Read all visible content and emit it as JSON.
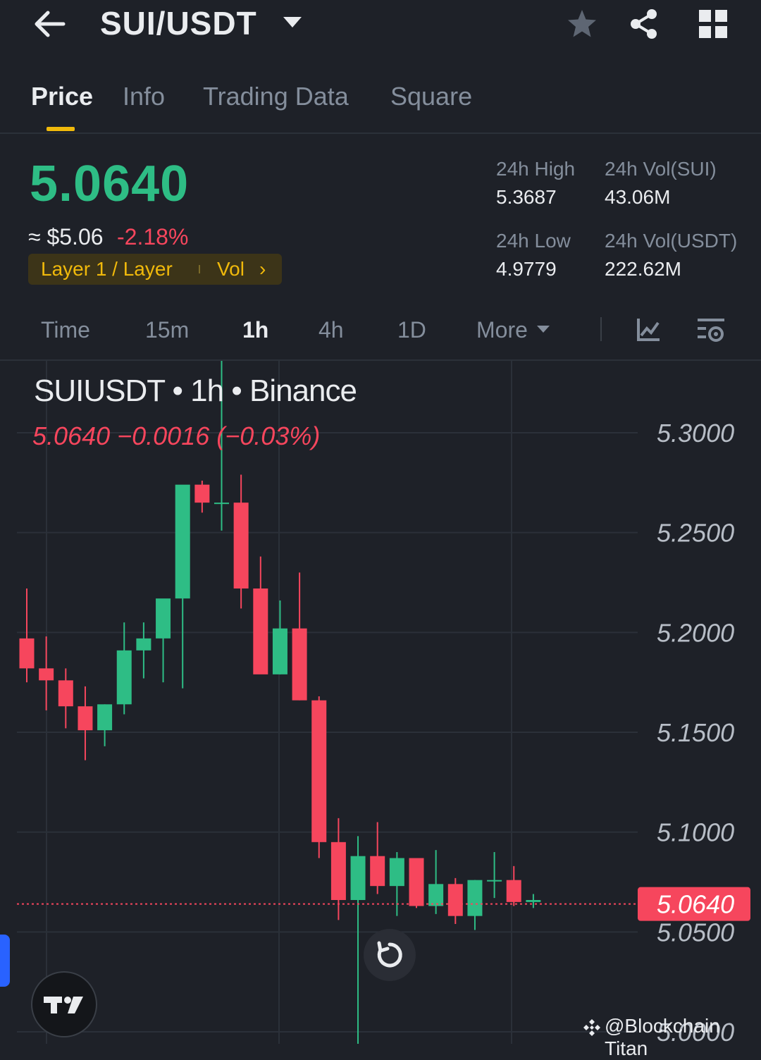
{
  "header": {
    "pair": "SUI/USDT",
    "icons": [
      "back-arrow-icon",
      "caret-down-icon",
      "star-icon",
      "share-icon",
      "grid-icon"
    ]
  },
  "tabs": [
    {
      "label": "Price",
      "active": true
    },
    {
      "label": "Info",
      "active": false
    },
    {
      "label": "Trading Data",
      "active": false
    },
    {
      "label": "Square",
      "active": false
    }
  ],
  "price": {
    "last": "5.0640",
    "fiat": "≈ $5.06",
    "change_pct": "-2.18%",
    "tag_category": "Layer 1 / Layer",
    "tag_vol": "Vol",
    "tag_chevron": "›"
  },
  "stats": {
    "high_label": "24h High",
    "high_value": "5.3687",
    "low_label": "24h Low",
    "low_value": "4.9779",
    "vol_base_label": "24h Vol(SUI)",
    "vol_base_value": "43.06M",
    "vol_quote_label": "24h Vol(USDT)",
    "vol_quote_value": "222.62M"
  },
  "intervals": [
    {
      "label": "Time",
      "active": false
    },
    {
      "label": "15m",
      "active": false
    },
    {
      "label": "1h",
      "active": true
    },
    {
      "label": "4h",
      "active": false
    },
    {
      "label": "1D",
      "active": false
    },
    {
      "label": "More",
      "active": false
    }
  ],
  "chart": {
    "title": "SUIUSDT • 1h • Binance",
    "subtitle": "5.0640  −0.0016 (−0.03%)",
    "price_tag": "5.0640",
    "y_ticks": [
      "5.3000",
      "5.2500",
      "5.2000",
      "5.1500",
      "5.1000",
      "5.0500",
      "5.0000"
    ],
    "watermark": "@Blockchain Titan"
  },
  "chart_data": {
    "type": "candlestick",
    "interval": "1h",
    "ylim": [
      4.994,
      5.336
    ],
    "y_ticks": [
      5.3,
      5.25,
      5.2,
      5.15,
      5.1,
      5.05,
      5.0
    ],
    "last_price": 5.064,
    "up_color": "#2ebd85",
    "down_color": "#f6465d",
    "candles": [
      {
        "o": 5.197,
        "h": 5.222,
        "l": 5.175,
        "c": 5.182
      },
      {
        "o": 5.182,
        "h": 5.198,
        "l": 5.161,
        "c": 5.176
      },
      {
        "o": 5.176,
        "h": 5.182,
        "l": 5.152,
        "c": 5.163
      },
      {
        "o": 5.163,
        "h": 5.173,
        "l": 5.136,
        "c": 5.151
      },
      {
        "o": 5.151,
        "h": 5.164,
        "l": 5.143,
        "c": 5.164
      },
      {
        "o": 5.164,
        "h": 5.205,
        "l": 5.159,
        "c": 5.191
      },
      {
        "o": 5.191,
        "h": 5.205,
        "l": 5.177,
        "c": 5.197
      },
      {
        "o": 5.197,
        "h": 5.216,
        "l": 5.175,
        "c": 5.217
      },
      {
        "o": 5.217,
        "h": 5.273,
        "l": 5.172,
        "c": 5.274
      },
      {
        "o": 5.274,
        "h": 5.276,
        "l": 5.26,
        "c": 5.265
      },
      {
        "o": 5.265,
        "h": 5.336,
        "l": 5.251,
        "c": 5.265
      },
      {
        "o": 5.265,
        "h": 5.279,
        "l": 5.212,
        "c": 5.222
      },
      {
        "o": 5.222,
        "h": 5.238,
        "l": 5.193,
        "c": 5.179
      },
      {
        "o": 5.179,
        "h": 5.216,
        "l": 5.179,
        "c": 5.202
      },
      {
        "o": 5.202,
        "h": 5.23,
        "l": 5.166,
        "c": 5.166
      },
      {
        "o": 5.166,
        "h": 5.168,
        "l": 5.087,
        "c": 5.095
      },
      {
        "o": 5.095,
        "h": 5.107,
        "l": 5.056,
        "c": 5.066
      },
      {
        "o": 5.066,
        "h": 5.098,
        "l": 4.994,
        "c": 5.088
      },
      {
        "o": 5.088,
        "h": 5.105,
        "l": 5.069,
        "c": 5.073
      },
      {
        "o": 5.073,
        "h": 5.09,
        "l": 5.058,
        "c": 5.087
      },
      {
        "o": 5.087,
        "h": 5.087,
        "l": 5.062,
        "c": 5.063
      },
      {
        "o": 5.063,
        "h": 5.091,
        "l": 5.059,
        "c": 5.074
      },
      {
        "o": 5.074,
        "h": 5.077,
        "l": 5.054,
        "c": 5.058
      },
      {
        "o": 5.058,
        "h": 5.076,
        "l": 5.051,
        "c": 5.076
      },
      {
        "o": 5.076,
        "h": 5.09,
        "l": 5.067,
        "c": 5.076
      },
      {
        "o": 5.076,
        "h": 5.083,
        "l": 5.063,
        "c": 5.065
      },
      {
        "o": 5.065,
        "h": 5.069,
        "l": 5.062,
        "c": 5.066
      }
    ]
  }
}
